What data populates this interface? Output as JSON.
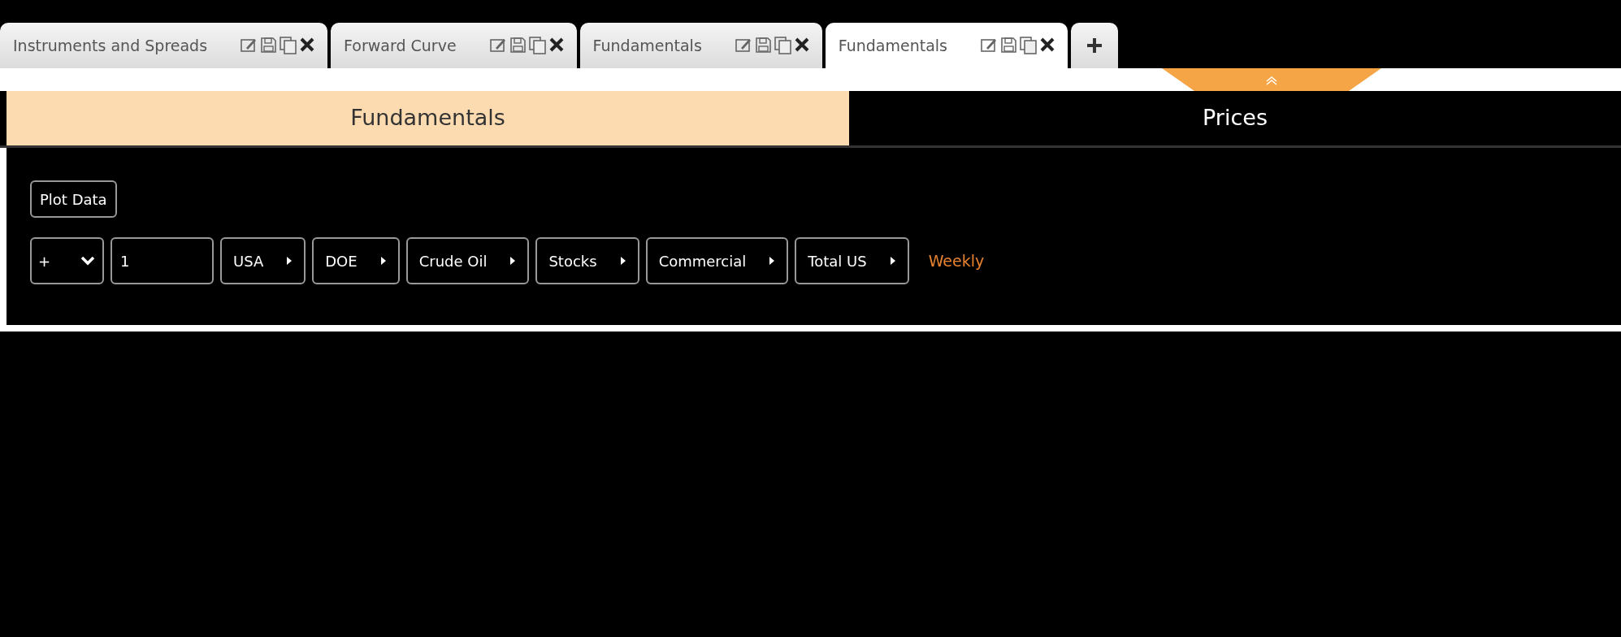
{
  "tabs": [
    {
      "label": "Instruments and Spreads",
      "selected": false
    },
    {
      "label": "Forward Curve",
      "selected": false
    },
    {
      "label": "Fundamentals",
      "selected": false
    },
    {
      "label": "Fundamentals",
      "selected": true
    }
  ],
  "sections": [
    {
      "label": "Fundamentals",
      "selected": true
    },
    {
      "label": "Prices",
      "selected": false
    }
  ],
  "plot_button": "Plot Data",
  "series_row": {
    "operator": "+",
    "value": "1",
    "selectors": [
      "USA",
      "DOE",
      "Crude Oil",
      "Stocks",
      "Commercial",
      "Total US"
    ],
    "frequency": "Weekly"
  }
}
